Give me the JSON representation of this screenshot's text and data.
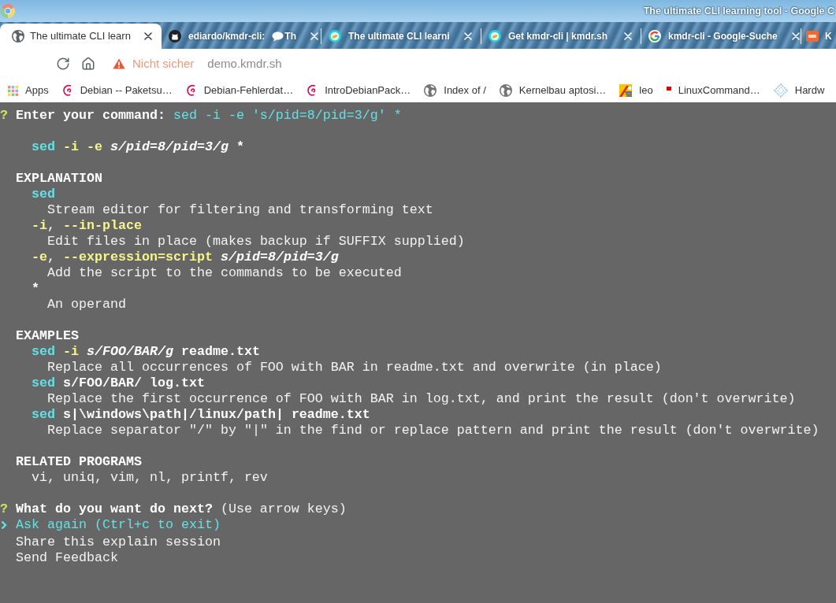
{
  "window": {
    "title": "The ultimate CLI learning tool - Google C"
  },
  "tabs": [
    {
      "kind": "globe",
      "title": "The ultimate CLI learn",
      "selected": true
    },
    {
      "kind": "cat",
      "title": "ediardo/kmdr-cli:",
      "title_rest": "Th",
      "selected": false
    },
    {
      "kind": "ring",
      "title": "The ultimate CLI learni",
      "selected": false
    },
    {
      "kind": "ring",
      "title": "Get kmdr-cli | kmdr.sh",
      "selected": false
    },
    {
      "kind": "gmark",
      "title": "kmdr-cli - Google-Suche",
      "selected": false
    },
    {
      "kind": "badge",
      "title": "K",
      "selected": false
    }
  ],
  "toolbar": {
    "security_label": "Nicht sicher",
    "url": "demo.kmdr.sh"
  },
  "bookmarks": [
    {
      "kind": "apps",
      "label": "Apps"
    },
    {
      "kind": "swirl",
      "label": "Debian -- Paketsu…"
    },
    {
      "kind": "swirl",
      "label": "Debian-Fehlerdat…"
    },
    {
      "kind": "swirl",
      "label": "IntroDebianPack…"
    },
    {
      "kind": "globe",
      "label": "Index of /"
    },
    {
      "kind": "globe",
      "label": "Kernelbau aptosi…"
    },
    {
      "kind": "flag",
      "label": "leo"
    },
    {
      "kind": "square",
      "label": "LinuxCommand…"
    },
    {
      "kind": "diamond",
      "label": "Hardw"
    }
  ],
  "terminal": {
    "prompt": {
      "symbol": "?",
      "question": "Enter your command:",
      "answer": "sed -i -e 's/pid=8/pid=3/g' *"
    },
    "parsed_command": [
      {
        "kind": "program",
        "text": "sed"
      },
      {
        "kind": "option",
        "text": "-i"
      },
      {
        "kind": "option",
        "text": "-e"
      },
      {
        "kind": "argument",
        "text": "s/pid=8/pid=3/g"
      },
      {
        "kind": "word",
        "text": "*"
      }
    ],
    "sections": [
      {
        "heading": "EXPLANATION",
        "entries": [
          {
            "term": [
              {
                "kind": "program",
                "text": "sed"
              }
            ],
            "description": "Stream editor for filtering and transforming text"
          },
          {
            "term": [
              {
                "kind": "option",
                "text": "-i"
              },
              {
                "kind": "punct",
                "text": ","
              },
              {
                "kind": "option",
                "text": "--in-place"
              }
            ],
            "description": "Edit files in place (makes backup if SUFFIX supplied)"
          },
          {
            "term": [
              {
                "kind": "option",
                "text": "-e"
              },
              {
                "kind": "punct",
                "text": ","
              },
              {
                "kind": "option",
                "text": "--expression=script"
              },
              {
                "kind": "argument",
                "text": "s/pid=8/pid=3/g"
              }
            ],
            "description": "Add the script to the commands to be executed"
          },
          {
            "term": [
              {
                "kind": "word",
                "text": "*"
              }
            ],
            "description": "An operand"
          }
        ]
      },
      {
        "heading": "EXAMPLES",
        "entries": [
          {
            "term": [
              {
                "kind": "program",
                "text": "sed"
              },
              {
                "kind": "option",
                "text": "-i"
              },
              {
                "kind": "argument",
                "text": "s/FOO/BAR/g"
              },
              {
                "kind": "word",
                "text": "readme.txt"
              }
            ],
            "description": "Replace all occurrences of FOO with BAR in readme.txt and overwrite (in place)"
          },
          {
            "term": [
              {
                "kind": "program",
                "text": "sed"
              },
              {
                "kind": "word",
                "text": "s/FOO/BAR/"
              },
              {
                "kind": "word",
                "text": "log.txt"
              }
            ],
            "description": "Replace the first occurrence of FOO with BAR in log.txt, and print the result (don't overwrite)"
          },
          {
            "term": [
              {
                "kind": "program",
                "text": "sed"
              },
              {
                "kind": "word",
                "text": "s|\\windows\\path|/linux/path|"
              },
              {
                "kind": "word",
                "text": "readme.txt"
              }
            ],
            "description": "Replace separator \"/\" by \"|\" in the find or replace pattern and print the result (don't overwrite)"
          }
        ]
      }
    ],
    "related": {
      "heading": "RELATED PROGRAMS",
      "text": "vi, uniq, vim, nl, printf, rev"
    },
    "menu": {
      "symbol": "?",
      "question": "What do you want do next?",
      "hint": "(Use arrow keys)",
      "options": [
        {
          "label": "Ask again (Ctrl+c to exit)",
          "selected": true
        },
        {
          "label": "Share this explain session",
          "selected": false
        },
        {
          "label": "Send Feedback",
          "selected": false
        }
      ]
    }
  }
}
